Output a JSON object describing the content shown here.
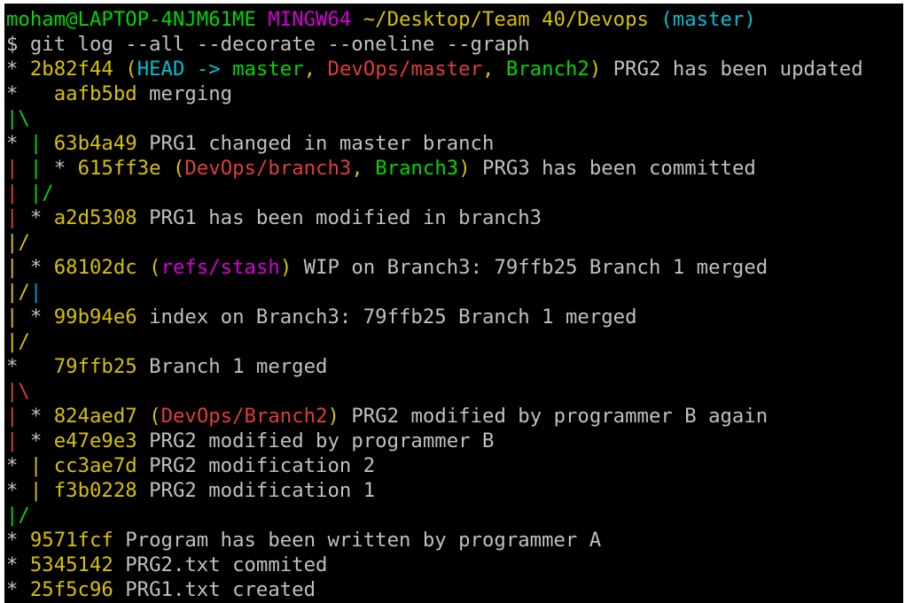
{
  "terminal": {
    "background": "#000000",
    "lines": [
      [
        {
          "t": "moham@LAPTOP-4NJM61ME",
          "c": "#00d700"
        },
        {
          "t": " ",
          "c": "#c0c0c0"
        },
        {
          "t": "MINGW64",
          "c": "#d400d4"
        },
        {
          "t": " ",
          "c": "#c0c0c0"
        },
        {
          "t": "~/Desktop/Team 40/Devops",
          "c": "#d7c000"
        },
        {
          "t": " ",
          "c": "#c0c0c0"
        },
        {
          "t": "(master)",
          "c": "#00c0d0"
        }
      ],
      [
        {
          "t": "$ git log --all --decorate --oneline --graph",
          "c": "#c0c0c0"
        }
      ],
      [
        {
          "t": "* ",
          "c": "#c0c0c0"
        },
        {
          "t": "2b82f44",
          "c": "#d7c000"
        },
        {
          "t": " ",
          "c": "#c0c0c0"
        },
        {
          "t": "(",
          "c": "#d7c000"
        },
        {
          "t": "HEAD -> ",
          "c": "#00c0d0"
        },
        {
          "t": "master",
          "c": "#00d700"
        },
        {
          "t": ", ",
          "c": "#d7c000"
        },
        {
          "t": "DevOps/master",
          "c": "#e03c3c"
        },
        {
          "t": ", ",
          "c": "#d7c000"
        },
        {
          "t": "Branch2",
          "c": "#00d700"
        },
        {
          "t": ")",
          "c": "#d7c000"
        },
        {
          "t": " PRG2 has been updated",
          "c": "#c0c0c0"
        }
      ],
      [
        {
          "t": "*   ",
          "c": "#c0c0c0"
        },
        {
          "t": "aafb5bd",
          "c": "#d7c000"
        },
        {
          "t": " merging",
          "c": "#c0c0c0"
        }
      ],
      [
        {
          "t": "|\\",
          "c": "#00d700"
        }
      ],
      [
        {
          "t": "* ",
          "c": "#c0c0c0"
        },
        {
          "t": "| ",
          "c": "#00d700"
        },
        {
          "t": "63b4a49",
          "c": "#d7c000"
        },
        {
          "t": " PRG1 changed in master branch",
          "c": "#c0c0c0"
        }
      ],
      [
        {
          "t": "| ",
          "c": "#e03c3c"
        },
        {
          "t": "| ",
          "c": "#00d700"
        },
        {
          "t": "* ",
          "c": "#c0c0c0"
        },
        {
          "t": "615ff3e",
          "c": "#d7c000"
        },
        {
          "t": " ",
          "c": "#c0c0c0"
        },
        {
          "t": "(",
          "c": "#d7c000"
        },
        {
          "t": "DevOps/branch3",
          "c": "#e03c3c"
        },
        {
          "t": ", ",
          "c": "#d7c000"
        },
        {
          "t": "Branch3",
          "c": "#00d700"
        },
        {
          "t": ")",
          "c": "#d7c000"
        },
        {
          "t": " PRG3 has been committed",
          "c": "#c0c0c0"
        }
      ],
      [
        {
          "t": "| ",
          "c": "#e03c3c"
        },
        {
          "t": "|/",
          "c": "#00d700"
        }
      ],
      [
        {
          "t": "| ",
          "c": "#e03c3c"
        },
        {
          "t": "* ",
          "c": "#c0c0c0"
        },
        {
          "t": "a2d5308",
          "c": "#d7c000"
        },
        {
          "t": " PRG1 has been modified in branch3",
          "c": "#c0c0c0"
        }
      ],
      [
        {
          "t": "|/",
          "c": "#d7c000"
        }
      ],
      [
        {
          "t": "| ",
          "c": "#d7c000"
        },
        {
          "t": "* ",
          "c": "#c0c0c0"
        },
        {
          "t": "68102dc",
          "c": "#d7c000"
        },
        {
          "t": " ",
          "c": "#c0c0c0"
        },
        {
          "t": "(",
          "c": "#d7c000"
        },
        {
          "t": "refs/stash",
          "c": "#d400d4"
        },
        {
          "t": ")",
          "c": "#d7c000"
        },
        {
          "t": " WIP on Branch3: 79ffb25 Branch 1 merged",
          "c": "#c0c0c0"
        }
      ],
      [
        {
          "t": "|/",
          "c": "#d7c000"
        },
        {
          "t": "|",
          "c": "#00a0d0"
        }
      ],
      [
        {
          "t": "| ",
          "c": "#d7c000"
        },
        {
          "t": "* ",
          "c": "#c0c0c0"
        },
        {
          "t": "99b94e6",
          "c": "#d7c000"
        },
        {
          "t": " index on Branch3: 79ffb25 Branch 1 merged",
          "c": "#c0c0c0"
        }
      ],
      [
        {
          "t": "|/",
          "c": "#d7c000"
        }
      ],
      [
        {
          "t": "*   ",
          "c": "#c0c0c0"
        },
        {
          "t": "79ffb25",
          "c": "#d7c000"
        },
        {
          "t": " Branch 1 merged",
          "c": "#c0c0c0"
        }
      ],
      [
        {
          "t": "|\\",
          "c": "#e03c3c"
        }
      ],
      [
        {
          "t": "| ",
          "c": "#e03c3c"
        },
        {
          "t": "* ",
          "c": "#c0c0c0"
        },
        {
          "t": "824aed7",
          "c": "#d7c000"
        },
        {
          "t": " ",
          "c": "#c0c0c0"
        },
        {
          "t": "(",
          "c": "#d7c000"
        },
        {
          "t": "DevOps/Branch2",
          "c": "#e03c3c"
        },
        {
          "t": ")",
          "c": "#d7c000"
        },
        {
          "t": " PRG2 modified by programmer B again",
          "c": "#c0c0c0"
        }
      ],
      [
        {
          "t": "| ",
          "c": "#e03c3c"
        },
        {
          "t": "* ",
          "c": "#c0c0c0"
        },
        {
          "t": "e47e9e3",
          "c": "#d7c000"
        },
        {
          "t": " PRG2 modified by programmer B",
          "c": "#c0c0c0"
        }
      ],
      [
        {
          "t": "* ",
          "c": "#c0c0c0"
        },
        {
          "t": "| ",
          "c": "#d7c000"
        },
        {
          "t": "cc3ae7d",
          "c": "#d7c000"
        },
        {
          "t": " PRG2 modification 2",
          "c": "#c0c0c0"
        }
      ],
      [
        {
          "t": "* ",
          "c": "#c0c0c0"
        },
        {
          "t": "| ",
          "c": "#d7c000"
        },
        {
          "t": "f3b0228",
          "c": "#d7c000"
        },
        {
          "t": " PRG2 modification 1",
          "c": "#c0c0c0"
        }
      ],
      [
        {
          "t": "|/",
          "c": "#00d700"
        }
      ],
      [
        {
          "t": "* ",
          "c": "#c0c0c0"
        },
        {
          "t": "9571fcf",
          "c": "#d7c000"
        },
        {
          "t": " Program has been written by programmer A",
          "c": "#c0c0c0"
        }
      ],
      [
        {
          "t": "* ",
          "c": "#c0c0c0"
        },
        {
          "t": "5345142",
          "c": "#d7c000"
        },
        {
          "t": " PRG2.txt commited",
          "c": "#c0c0c0"
        }
      ],
      [
        {
          "t": "* ",
          "c": "#c0c0c0"
        },
        {
          "t": "25f5c96",
          "c": "#d7c000"
        },
        {
          "t": " PRG1.txt created",
          "c": "#c0c0c0"
        }
      ]
    ]
  }
}
